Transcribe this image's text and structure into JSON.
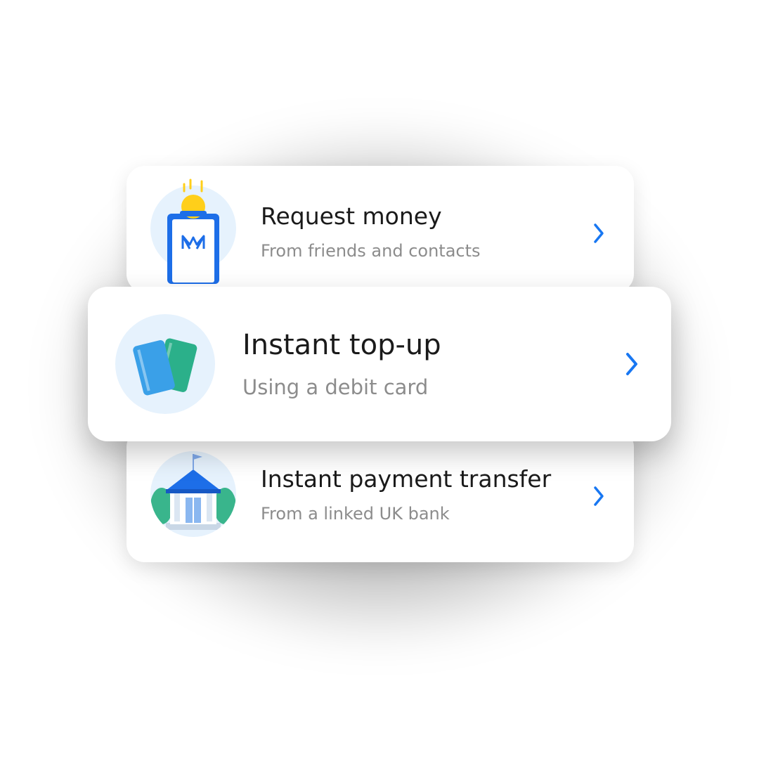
{
  "items": [
    {
      "title": "Request money",
      "subtitle": "From friends and contacts",
      "icon": "request-money-icon",
      "chevron": "chevron-right-icon"
    },
    {
      "title": "Instant top-up",
      "subtitle": "Using a debit card",
      "icon": "debit-cards-icon",
      "chevron": "chevron-right-icon"
    },
    {
      "title": "Instant payment transfer",
      "subtitle": "From a linked UK bank",
      "icon": "bank-icon",
      "chevron": "chevron-right-icon"
    }
  ],
  "colors": {
    "accent": "#1877f2",
    "icon_bg": "#e6f2fd",
    "title": "#1a1a1a",
    "subtitle": "#8c8c8c",
    "coin": "#ffcf1a",
    "card_blue": "#3aa0e8",
    "card_green": "#2bb08a",
    "bank_roof": "#1d6ee8",
    "tree": "#39b58c"
  }
}
